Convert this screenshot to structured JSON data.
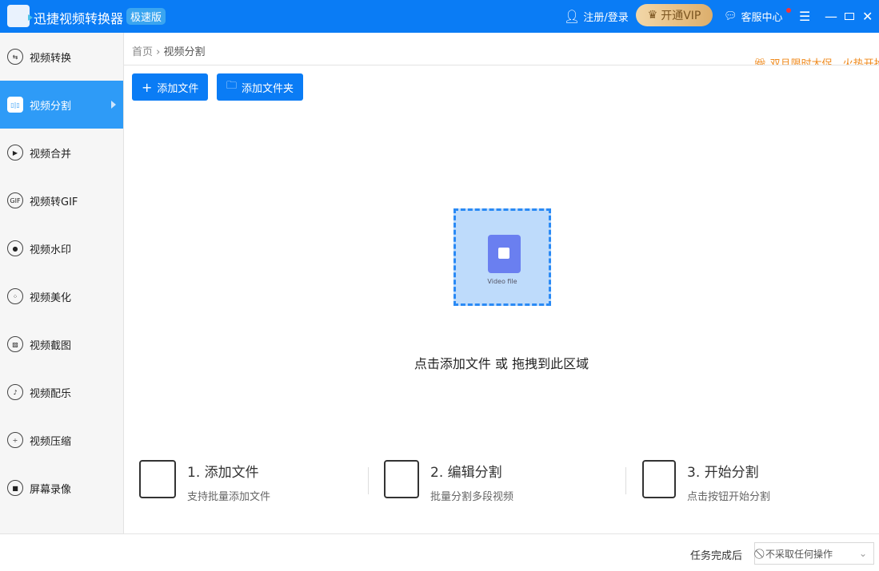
{
  "app": {
    "title": "迅捷视频转换器",
    "edition": "极速版"
  },
  "header": {
    "login": "注册/登录",
    "vip": "开通VIP",
    "support": "客服中心"
  },
  "sidebar": {
    "items": [
      {
        "label": "视频转换",
        "icon": "⇆"
      },
      {
        "label": "视频分割",
        "icon": "▯|▯"
      },
      {
        "label": "视频合并",
        "icon": "▶"
      },
      {
        "label": "视频转GIF",
        "icon": "GIF"
      },
      {
        "label": "视频水印",
        "icon": "●"
      },
      {
        "label": "视频美化",
        "icon": "⁘"
      },
      {
        "label": "视频截图",
        "icon": "▨"
      },
      {
        "label": "视频配乐",
        "icon": "♪"
      },
      {
        "label": "视频压缩",
        "icon": "÷"
      },
      {
        "label": "屏幕录像",
        "icon": "■"
      }
    ]
  },
  "breadcrumb": {
    "home": "首页",
    "current": "视频分割"
  },
  "promo": "双旦限时大促，火热开抢",
  "toolbar": {
    "add_file": "添加文件",
    "add_folder": "添加文件夹"
  },
  "dropzone": {
    "file_label": "Video file",
    "hint": "点击添加文件 或 拖拽到此区域"
  },
  "steps": [
    {
      "title": "1. 添加文件",
      "desc": "支持批量添加文件"
    },
    {
      "title": "2. 编辑分割",
      "desc": "批量分割多段视频"
    },
    {
      "title": "3. 开始分割",
      "desc": "点击按钮开始分割"
    }
  ],
  "footer": {
    "label": "任务完成后",
    "selected": "不采取任何操作"
  }
}
